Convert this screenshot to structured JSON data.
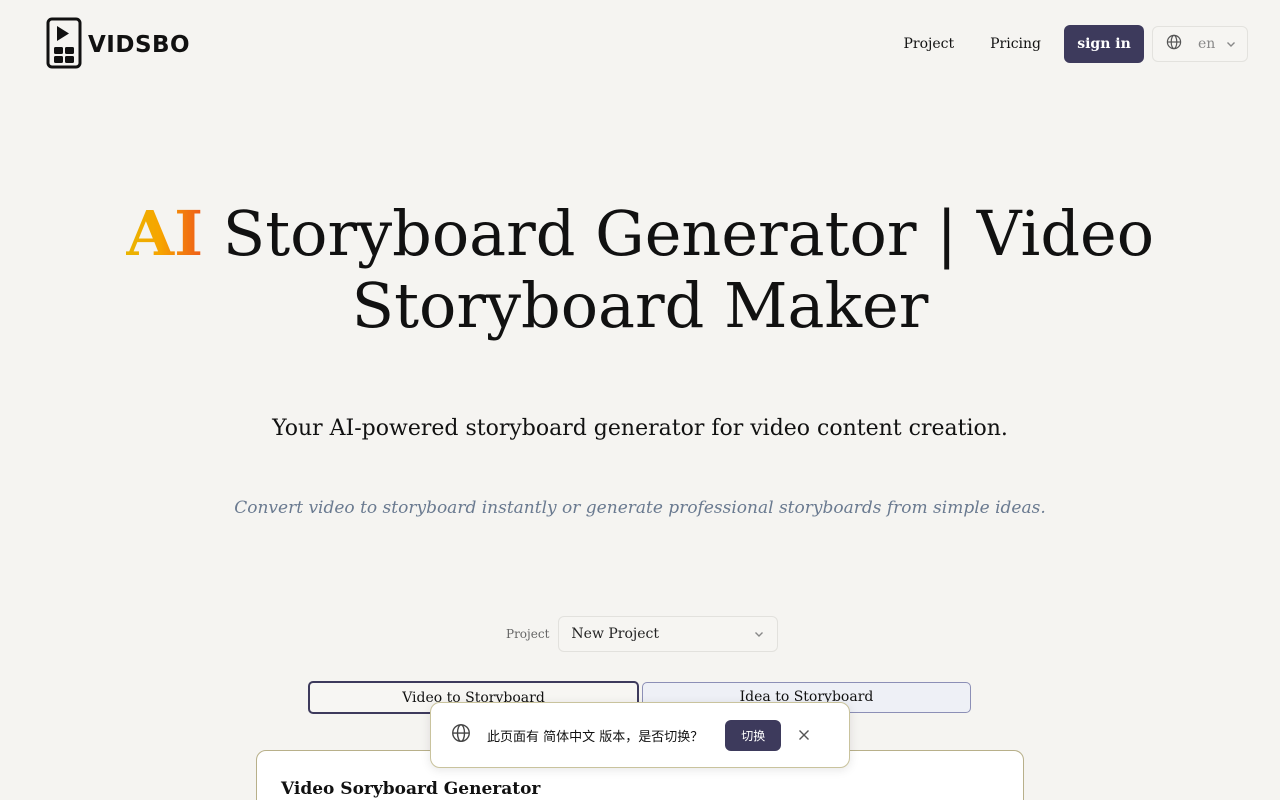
{
  "header": {
    "logo_text": "VIDSBO",
    "nav": {
      "project": "Project",
      "pricing": "Pricing",
      "sign_in": "sign in"
    },
    "language": {
      "selected": "en"
    }
  },
  "hero": {
    "title_highlight": "AI",
    "title_line1_rest": " Storyboard Generator | Video",
    "title_line2": "Storyboard Maker",
    "subtitle": "Your AI-powered storyboard generator for video content creation.",
    "tagline": "Convert video to storyboard instantly or generate professional storyboards from simple ideas."
  },
  "project_picker": {
    "label": "Project",
    "selected": "New Project"
  },
  "tabs": [
    {
      "label": "Video to Storyboard",
      "active": true
    },
    {
      "label": "Idea to Storyboard",
      "active": false
    }
  ],
  "card": {
    "title": "Video Sorybo​ard Generator"
  },
  "translate_popup": {
    "message": "此页面有 简体中文 版本，是否切换？",
    "switch_label": "切换"
  },
  "colors": {
    "accent": "#3d3a5c",
    "background": "#f5f4f1",
    "tagline": "#6a7a90",
    "ai_gradient_start": "#e9b400",
    "ai_gradient_end": "#ee5a1a"
  },
  "icons": {
    "logo": "film-storyboard-icon",
    "language": "globe-icon",
    "dropdown": "chevron-down-icon",
    "close": "close-icon"
  }
}
